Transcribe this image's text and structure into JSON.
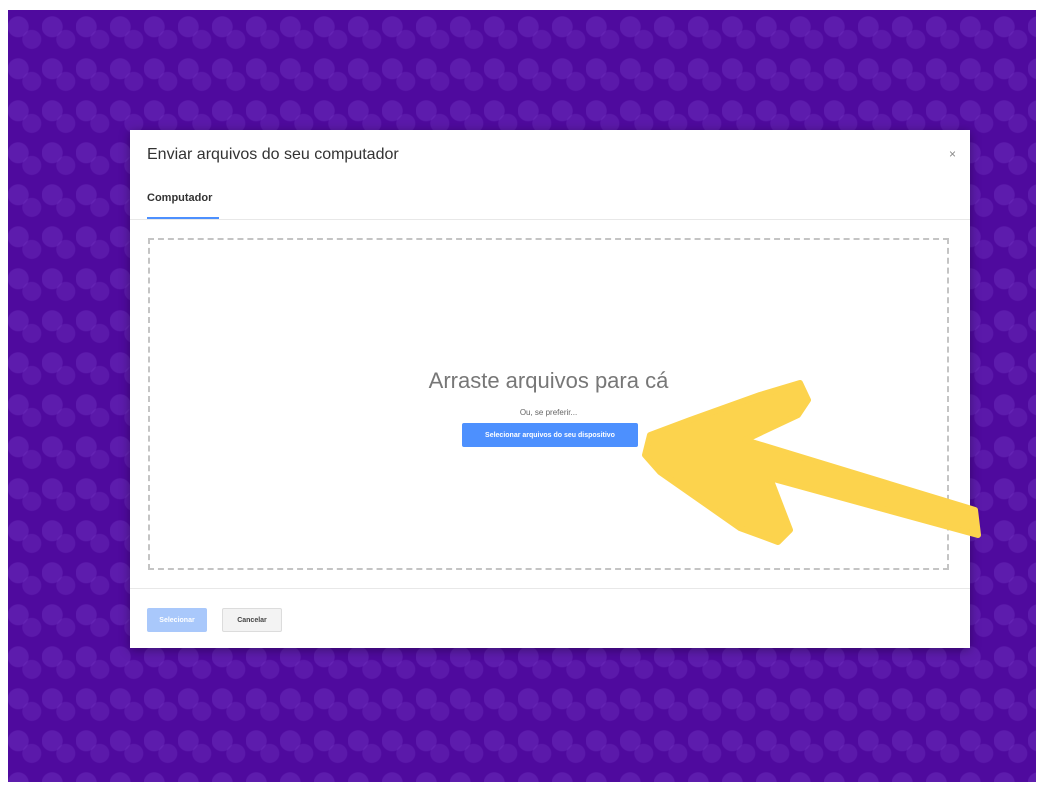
{
  "dialog": {
    "title": "Enviar arquivos do seu computador",
    "close_label": "×",
    "tabs": [
      {
        "label": "Computador",
        "active": true
      }
    ]
  },
  "dropzone": {
    "title": "Arraste arquivos para cá",
    "subtitle": "Ou, se preferir...",
    "select_button_label": "Selecionar arquivos do seu dispositivo"
  },
  "footer": {
    "primary_label": "Selecionar",
    "cancel_label": "Cancelar"
  },
  "colors": {
    "background": "#4f0a9e",
    "accent": "#4d90fe",
    "annotation_arrow": "#fcd34d"
  },
  "icons": {
    "close": "close-icon",
    "annotation": "arrow-annotation"
  }
}
